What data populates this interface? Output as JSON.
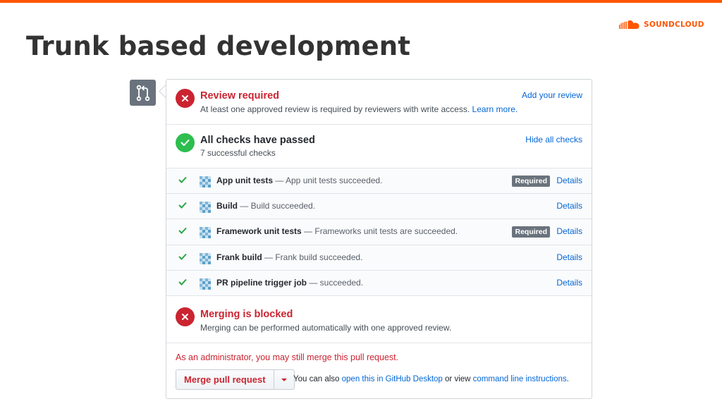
{
  "slide": {
    "title": "Trunk based development",
    "brand": "SOUNDCLOUD",
    "accent_color": "#ff5500"
  },
  "review": {
    "title": "Review required",
    "description": "At least one approved review is required by reviewers with write access.",
    "learn_more": "Learn more.",
    "action": "Add your review",
    "icon": "x-circle-icon"
  },
  "checks_summary": {
    "title": "All checks have passed",
    "subtitle": "7 successful checks",
    "action": "Hide all checks",
    "icon": "check-circle-icon"
  },
  "checks": [
    {
      "name": "App unit tests",
      "message": " — App unit tests succeeded.",
      "badge": "Required",
      "details": "Details"
    },
    {
      "name": "Build",
      "message": " — Build succeeded.",
      "badge": "",
      "details": "Details"
    },
    {
      "name": "Framework unit tests",
      "message": " — Frameworks unit tests are succeeded.",
      "badge": "Required",
      "details": "Details"
    },
    {
      "name": "Frank build",
      "message": " — Frank build succeeded.",
      "badge": "",
      "details": "Details"
    },
    {
      "name": "PR pipeline trigger job",
      "message": " — succeeded.",
      "badge": "",
      "details": "Details"
    }
  ],
  "merge_status": {
    "title": "Merging is blocked",
    "description": "Merging can be performed automatically with one approved review."
  },
  "admin": {
    "note": "As an administrator, you may still merge this pull request.",
    "merge_button": "Merge pull request",
    "hint_prefix": "You can also ",
    "hint_link1": "open this in GitHub Desktop",
    "hint_middle": " or view ",
    "hint_link2": "command line instructions",
    "hint_suffix": "."
  },
  "colors": {
    "error": "#cb2431",
    "success": "#2cbe4e",
    "link": "#0366d6",
    "badge": "#6a737d"
  }
}
